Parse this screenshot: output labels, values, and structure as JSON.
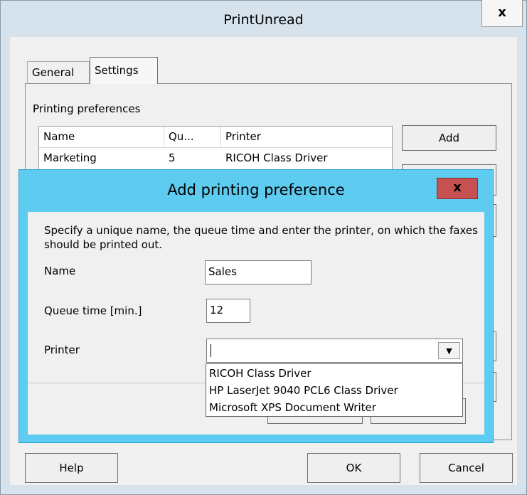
{
  "window": {
    "title": "PrintUnread",
    "close_glyph": "x"
  },
  "tabs": [
    {
      "label": "General"
    },
    {
      "label": "Settings"
    }
  ],
  "settings": {
    "section_label": "Printing preferences",
    "table": {
      "columns": [
        "Name",
        "Qu...",
        "Printer"
      ],
      "rows": [
        [
          "Marketing",
          "5",
          "RICOH Class Driver"
        ]
      ]
    },
    "add_label": "Add"
  },
  "footer": {
    "help_label": "Help",
    "ok_label": "OK",
    "cancel_label": "Cancel"
  },
  "dialog": {
    "title": "Add printing preference",
    "close_glyph": "x",
    "description": "Specify a unique name, the queue time and enter the printer, on which the faxes should be printed out.",
    "name_label": "Name",
    "name_value": "Sales",
    "queue_label": "Queue time [min.]",
    "queue_value": "12",
    "printer_label": "Printer",
    "printer_value": "",
    "printer_options": [
      "RICOH Class Driver",
      "HP LaserJet 9040 PCL6 Class Driver",
      "Microsoft XPS Document Writer"
    ]
  },
  "colors": {
    "dialog_frame": "#5ecbf0",
    "dialog_close": "#c75050",
    "window_frame": "#d6e3ed"
  },
  "icons": {
    "close": "close-icon",
    "dropdown": "chevron-down-icon"
  }
}
